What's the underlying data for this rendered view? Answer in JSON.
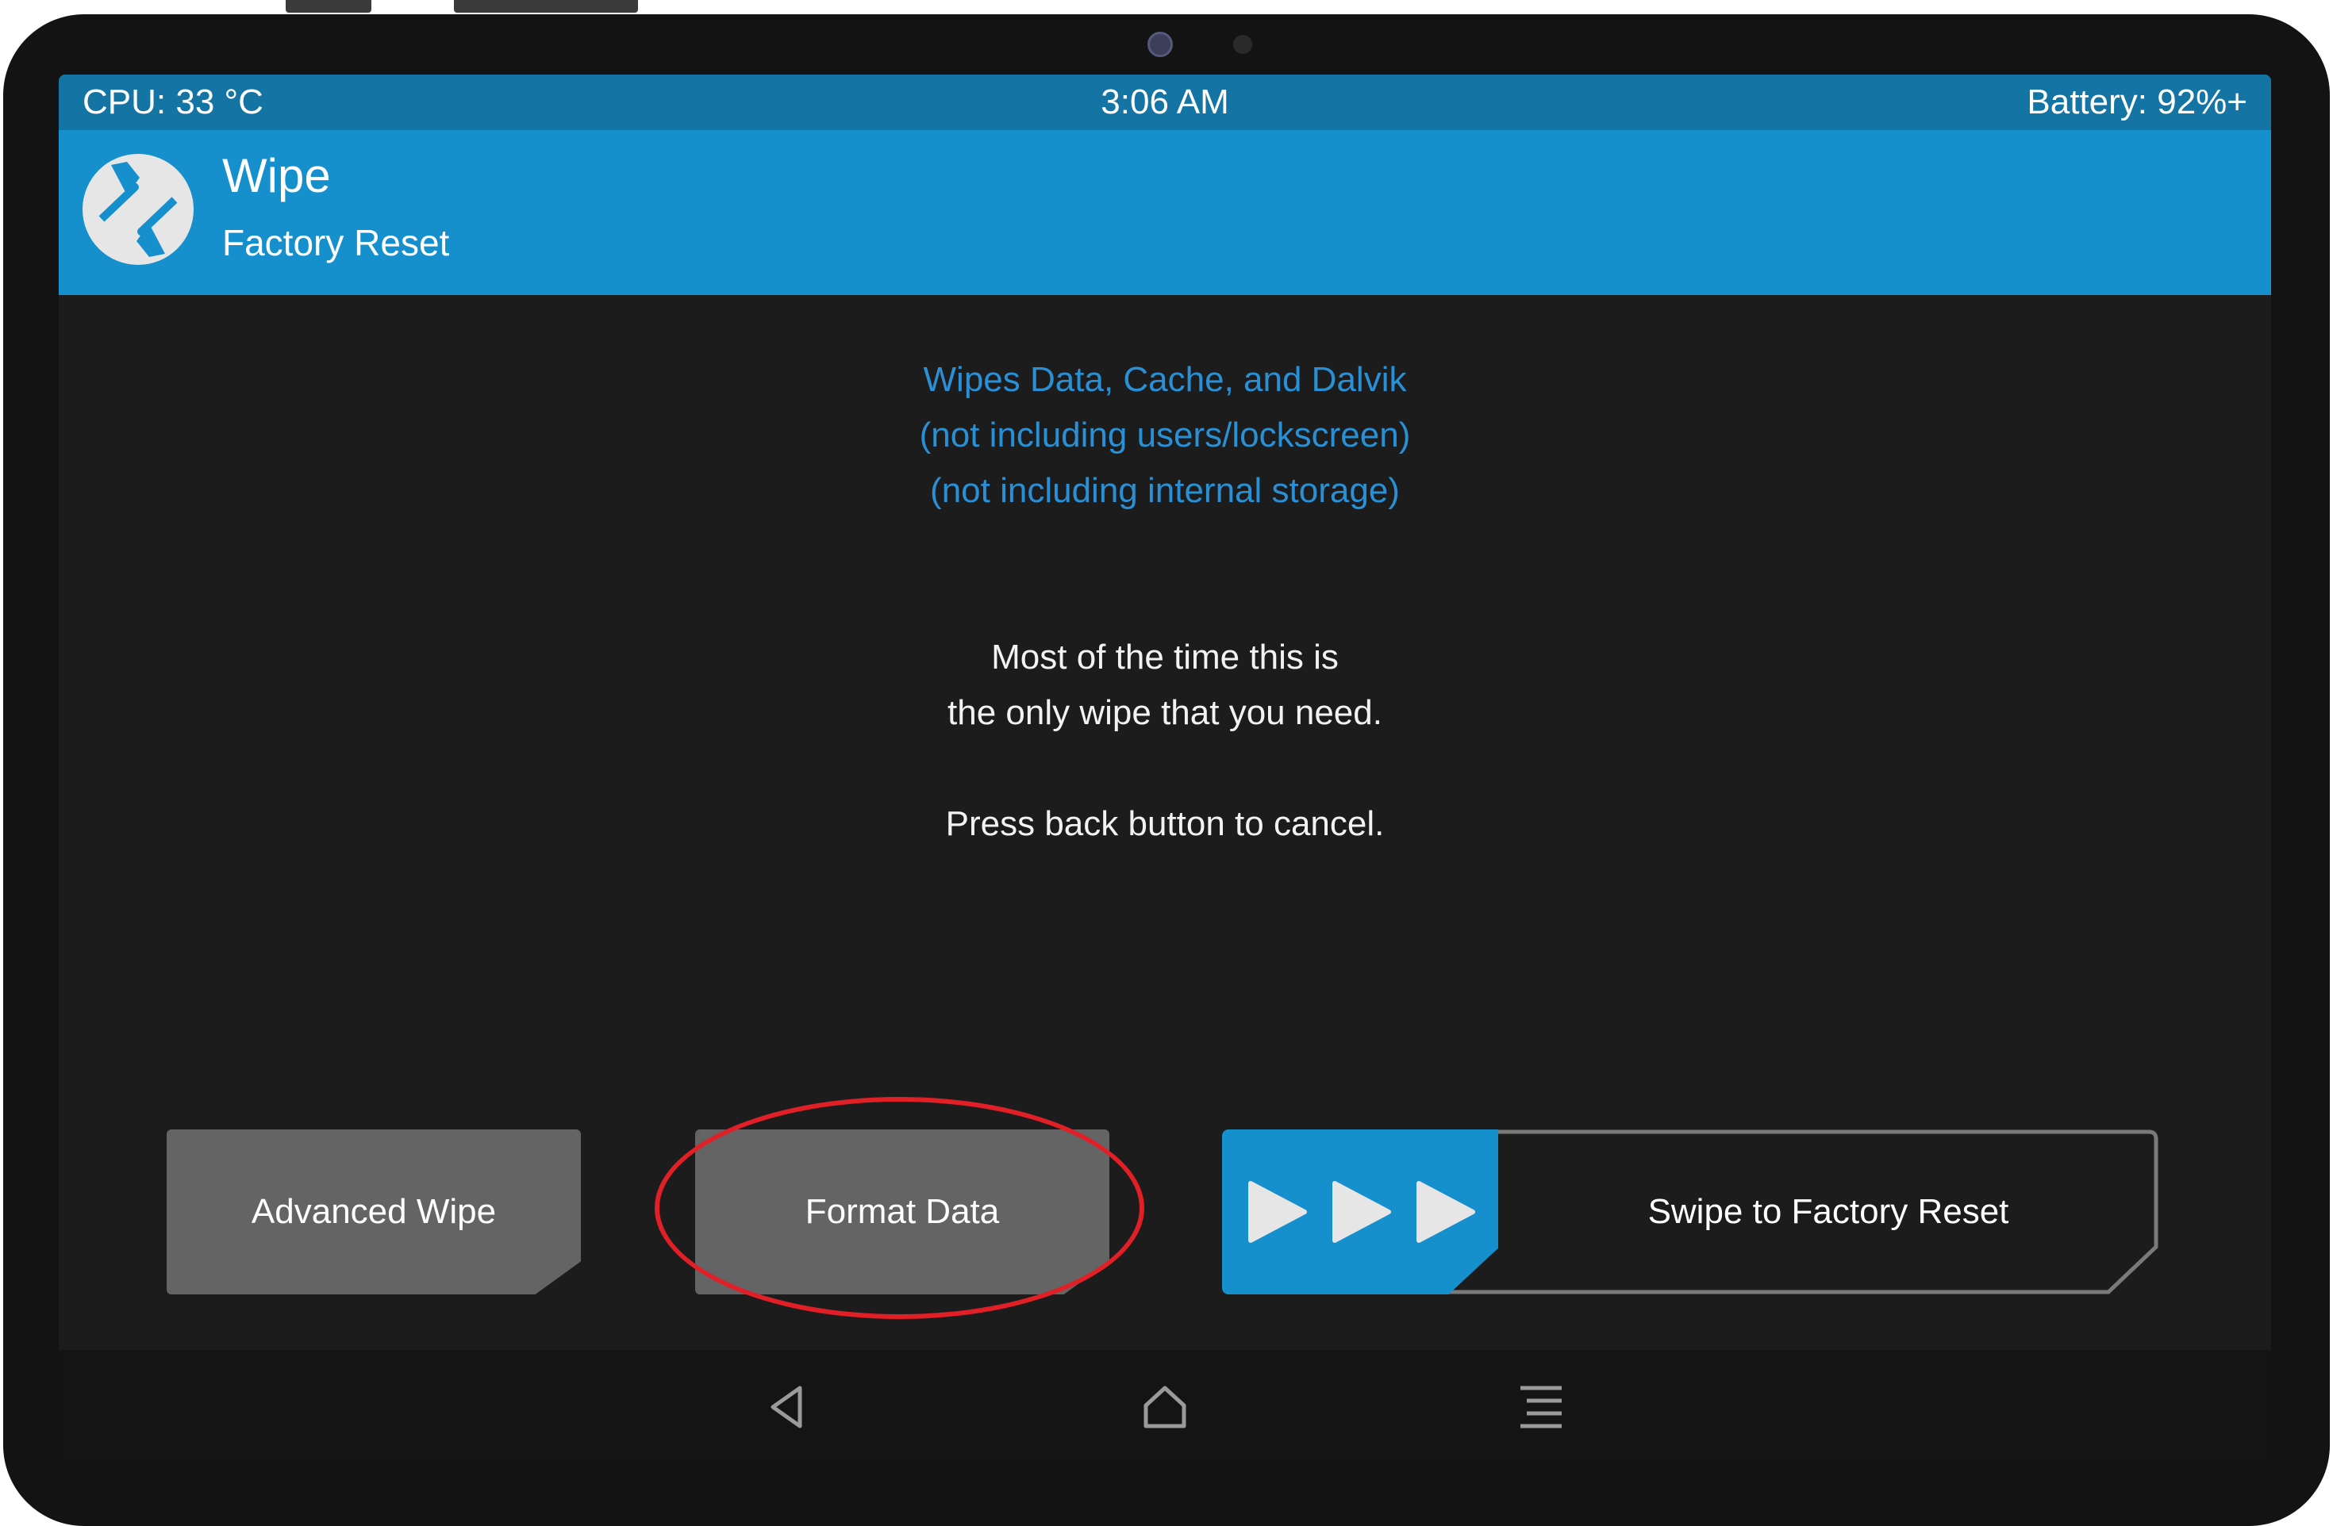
{
  "status_bar": {
    "cpu": "CPU: 33 °C",
    "time": "3:06 AM",
    "battery": "Battery: 92%+"
  },
  "header": {
    "title": "Wipe",
    "subtitle": "Factory Reset"
  },
  "info": {
    "line1": "Wipes Data, Cache, and Dalvik",
    "line2": "(not including users/lockscreen)",
    "line3": "(not including internal storage)"
  },
  "note": {
    "line1": "Most of the time this is",
    "line2": "the only wipe that you need.",
    "line3": "Press back button to cancel."
  },
  "buttons": {
    "advanced_wipe": "Advanced Wipe",
    "format_data": "Format Data"
  },
  "swipe": {
    "label": "Swipe to Factory Reset"
  },
  "colors": {
    "status_bar": "#1474a3",
    "title_bar": "#1690cd",
    "info_text": "#2a90d6",
    "highlight": "#e01f26"
  },
  "icons": [
    "twrp-logo-icon",
    "play-arrow-icon",
    "back-icon",
    "home-icon",
    "menu-icon"
  ]
}
